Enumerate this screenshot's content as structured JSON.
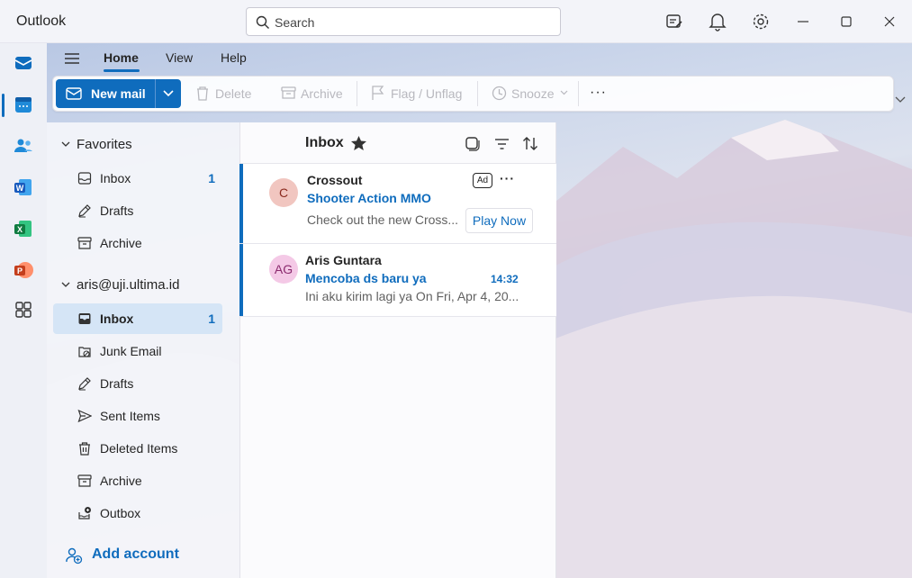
{
  "app": {
    "title": "Outlook"
  },
  "search": {
    "placeholder": "Search"
  },
  "ribbon": {
    "tabs": [
      {
        "label": "Home",
        "active": true
      },
      {
        "label": "View",
        "active": false
      },
      {
        "label": "Help",
        "active": false
      }
    ],
    "new_mail_label": "New mail",
    "buttons": [
      {
        "label": "Delete",
        "icon": "trash-icon",
        "enabled": false
      },
      {
        "label": "Archive",
        "icon": "archive-icon",
        "enabled": false
      },
      {
        "label": "Flag / Unflag",
        "icon": "flag-icon",
        "enabled": false
      },
      {
        "label": "Snooze",
        "icon": "clock-icon",
        "enabled": false
      }
    ],
    "more_label": "···"
  },
  "favorites": {
    "header": "Favorites",
    "items": [
      {
        "label": "Inbox",
        "count": "1",
        "icon": "inbox-icon"
      },
      {
        "label": "Drafts",
        "count": "",
        "icon": "drafts-icon"
      },
      {
        "label": "Archive",
        "count": "",
        "icon": "archive-icon"
      }
    ]
  },
  "account": {
    "header": "aris@uji.ultima.id",
    "items": [
      {
        "label": "Inbox",
        "count": "1",
        "icon": "inbox-icon",
        "selected": true
      },
      {
        "label": "Junk Email",
        "count": "",
        "icon": "junk-icon"
      },
      {
        "label": "Drafts",
        "count": "",
        "icon": "drafts-icon"
      },
      {
        "label": "Sent Items",
        "count": "",
        "icon": "send-icon"
      },
      {
        "label": "Deleted Items",
        "count": "",
        "icon": "trash-icon"
      },
      {
        "label": "Archive",
        "count": "",
        "icon": "archive-icon"
      },
      {
        "label": "Outbox",
        "count": "",
        "icon": "outbox-icon"
      }
    ]
  },
  "add_account_label": "Add account",
  "list": {
    "title": "Inbox",
    "messages": [
      {
        "initials": "C",
        "sender": "Crossout",
        "subject": "Shooter Action MMO",
        "preview": "Check out the new Cross...",
        "ad_label": "Ad",
        "more": "···",
        "action": "Play Now",
        "avatar_bg": "#f1c6c0",
        "avatar_fg": "#8a2a1e"
      },
      {
        "initials": "AG",
        "sender": "Aris Guntara",
        "subject": "Mencoba ds baru ya",
        "preview": "Ini aku kirim lagi ya On Fri, Apr 4, 20...",
        "time": "14:32",
        "avatar_bg": "#f4c9e6",
        "avatar_fg": "#8b2a6e"
      }
    ]
  },
  "colors": {
    "accent": "#0f6cbd",
    "selected_bg": "#d5e5f6"
  }
}
